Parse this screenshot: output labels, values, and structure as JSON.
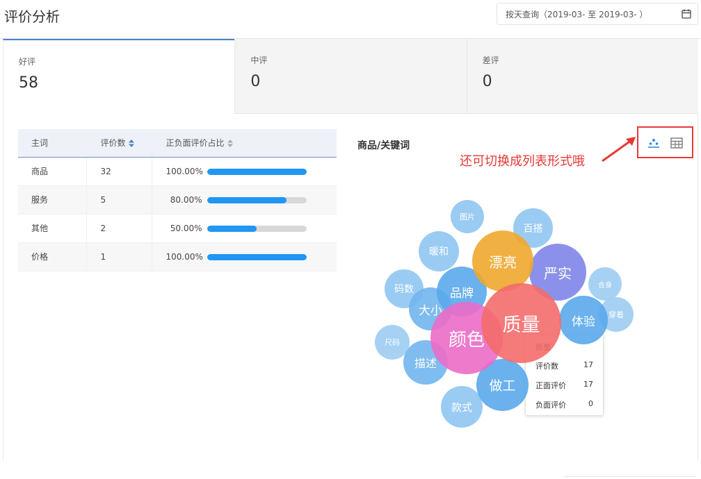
{
  "page": {
    "title": "评价分析"
  },
  "date_range": {
    "text": "按天查询（2019-03-  至 2019-03-  ）",
    "icon": "calendar-icon"
  },
  "stats": [
    {
      "label": "好评",
      "value": "58"
    },
    {
      "label": "中评",
      "value": "0"
    },
    {
      "label": "差评",
      "value": "0"
    }
  ],
  "table": {
    "headers": {
      "word": "主词",
      "count": "评价数",
      "ratio": "正负面评价占比"
    },
    "rows": [
      {
        "word": "商品",
        "count": "32",
        "pct_text": "100.00%",
        "pct": 100
      },
      {
        "word": "服务",
        "count": "5",
        "pct_text": "80.00%",
        "pct": 80
      },
      {
        "word": "其他",
        "count": "2",
        "pct_text": "50.00%",
        "pct": 50
      },
      {
        "word": "价格",
        "count": "1",
        "pct_text": "100.00%",
        "pct": 100
      }
    ]
  },
  "chart": {
    "title": "商品/关键词",
    "annotation": "还可切换成列表形式哦",
    "view_icons": [
      "bubble-chart-icon",
      "table-icon"
    ]
  },
  "bubbles": [
    {
      "label": "图片",
      "color": "#90c6f2"
    },
    {
      "label": "百搭",
      "color": "#90c6f2"
    },
    {
      "label": "暖和",
      "color": "#90c6f2"
    },
    {
      "label": "漂亮",
      "color": "#f0a82e"
    },
    {
      "label": "严实",
      "color": "#7f86e8"
    },
    {
      "label": "合身",
      "color": "#9dcdf2"
    },
    {
      "label": "码数",
      "color": "#90c6f2"
    },
    {
      "label": "品牌",
      "color": "#5aa9ec"
    },
    {
      "label": "大小",
      "color": "#72b5ee"
    },
    {
      "label": "体验",
      "color": "#5aa9ec"
    },
    {
      "label": "穿着",
      "color": "#9dcdf2"
    },
    {
      "label": "质量",
      "color": "#f46c6c"
    },
    {
      "label": "颜色",
      "color": "#ec6cc7"
    },
    {
      "label": "尺码",
      "color": "#9dcdf2"
    },
    {
      "label": "描述",
      "color": "#72b5ee"
    },
    {
      "label": "做工",
      "color": "#5aa9ec"
    },
    {
      "label": "款式",
      "color": "#90c6f2"
    }
  ],
  "tooltip": {
    "title": "质量",
    "rows": [
      {
        "label": "评价数",
        "value": "17"
      },
      {
        "label": "正面评价",
        "value": "17"
      },
      {
        "label": "负面评价",
        "value": "0"
      }
    ]
  }
}
